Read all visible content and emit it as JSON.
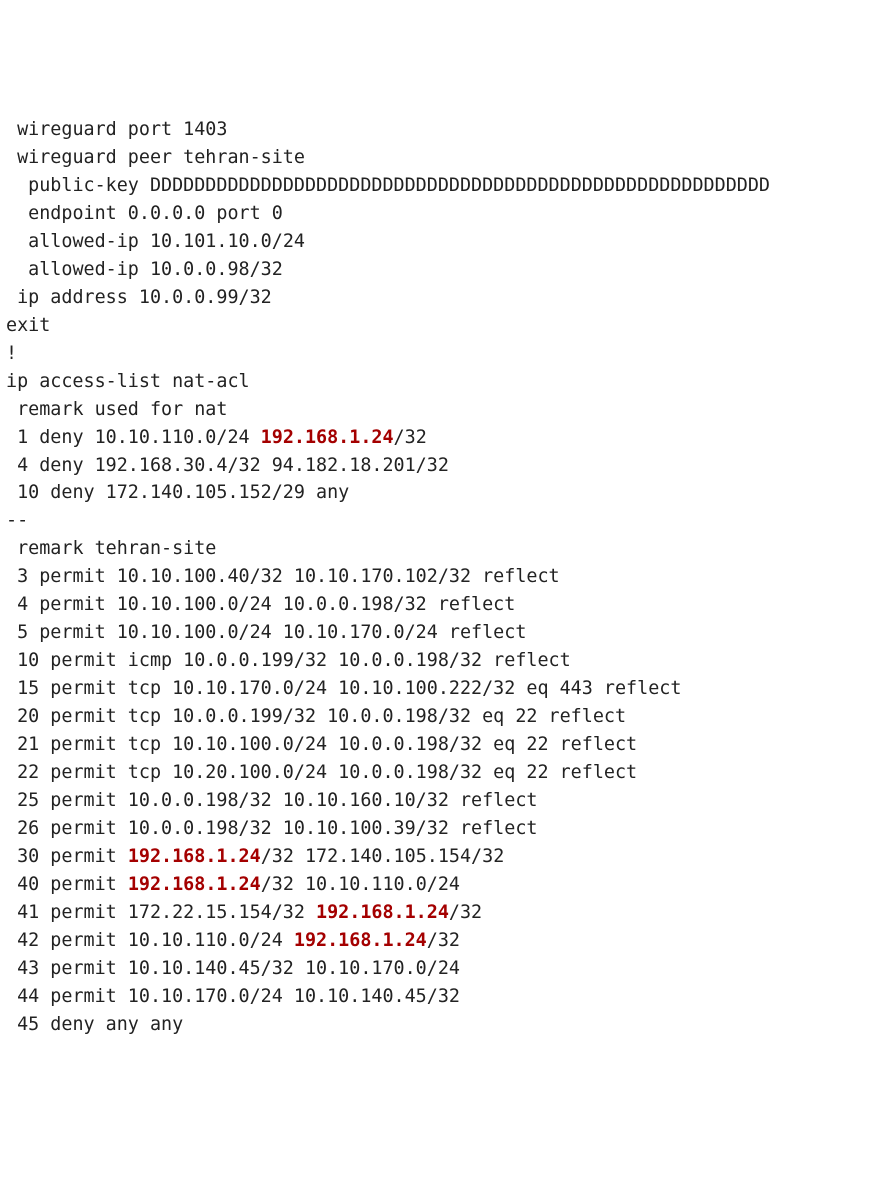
{
  "highlight_color": "#a40000",
  "lines": [
    {
      "indent": " ",
      "segments": [
        {
          "t": "wireguard port 1403"
        }
      ]
    },
    {
      "indent": " ",
      "segments": [
        {
          "t": "wireguard peer tehran-site"
        }
      ]
    },
    {
      "indent": "  ",
      "segments": [
        {
          "t": "public-key DDDDDDDDDDDDDDDDDDDDDDDDDDDDDDDDDDDDDDDDDDDDDDDDDDDDDDDD"
        }
      ]
    },
    {
      "indent": "  ",
      "segments": [
        {
          "t": "endpoint 0.0.0.0 port 0"
        }
      ]
    },
    {
      "indent": "  ",
      "segments": [
        {
          "t": "allowed-ip 10.101.10.0/24"
        }
      ]
    },
    {
      "indent": "  ",
      "segments": [
        {
          "t": "allowed-ip 10.0.0.98/32"
        }
      ]
    },
    {
      "indent": " ",
      "segments": [
        {
          "t": "ip address 10.0.0.99/32"
        }
      ]
    },
    {
      "indent": "",
      "segments": [
        {
          "t": "exit"
        }
      ]
    },
    {
      "indent": "",
      "segments": [
        {
          "t": "!"
        }
      ]
    },
    {
      "indent": "",
      "segments": [
        {
          "t": "ip access-list nat-acl"
        }
      ]
    },
    {
      "indent": " ",
      "segments": [
        {
          "t": "remark used for nat"
        }
      ]
    },
    {
      "indent": " ",
      "segments": [
        {
          "t": "1 deny 10.10.110.0/24 "
        },
        {
          "t": "192.168.1.24",
          "hl": true
        },
        {
          "t": "/32"
        }
      ]
    },
    {
      "indent": " ",
      "segments": [
        {
          "t": "4 deny 192.168.30.4/32 94.182.18.201/32"
        }
      ]
    },
    {
      "indent": " ",
      "segments": [
        {
          "t": "10 deny 172.140.105.152/29 any"
        }
      ]
    },
    {
      "indent": "",
      "segments": [
        {
          "t": "--"
        }
      ]
    },
    {
      "indent": " ",
      "segments": [
        {
          "t": "remark tehran-site"
        }
      ]
    },
    {
      "indent": " ",
      "segments": [
        {
          "t": "3 permit 10.10.100.40/32 10.10.170.102/32 reflect"
        }
      ]
    },
    {
      "indent": " ",
      "segments": [
        {
          "t": "4 permit 10.10.100.0/24 10.0.0.198/32 reflect"
        }
      ]
    },
    {
      "indent": " ",
      "segments": [
        {
          "t": "5 permit 10.10.100.0/24 10.10.170.0/24 reflect"
        }
      ]
    },
    {
      "indent": " ",
      "segments": [
        {
          "t": "10 permit icmp 10.0.0.199/32 10.0.0.198/32 reflect"
        }
      ]
    },
    {
      "indent": " ",
      "segments": [
        {
          "t": "15 permit tcp 10.10.170.0/24 10.10.100.222/32 eq 443 reflect"
        }
      ]
    },
    {
      "indent": " ",
      "segments": [
        {
          "t": "20 permit tcp 10.0.0.199/32 10.0.0.198/32 eq 22 reflect"
        }
      ]
    },
    {
      "indent": " ",
      "segments": [
        {
          "t": "21 permit tcp 10.10.100.0/24 10.0.0.198/32 eq 22 reflect"
        }
      ]
    },
    {
      "indent": " ",
      "segments": [
        {
          "t": "22 permit tcp 10.20.100.0/24 10.0.0.198/32 eq 22 reflect"
        }
      ]
    },
    {
      "indent": " ",
      "segments": [
        {
          "t": "25 permit 10.0.0.198/32 10.10.160.10/32 reflect"
        }
      ]
    },
    {
      "indent": " ",
      "segments": [
        {
          "t": "26 permit 10.0.0.198/32 10.10.100.39/32 reflect"
        }
      ]
    },
    {
      "indent": " ",
      "segments": [
        {
          "t": "30 permit "
        },
        {
          "t": "192.168.1.24",
          "hl": true
        },
        {
          "t": "/32 172.140.105.154/32"
        }
      ]
    },
    {
      "indent": " ",
      "segments": [
        {
          "t": "40 permit "
        },
        {
          "t": "192.168.1.24",
          "hl": true
        },
        {
          "t": "/32 10.10.110.0/24"
        }
      ]
    },
    {
      "indent": " ",
      "segments": [
        {
          "t": "41 permit 172.22.15.154/32 "
        },
        {
          "t": "192.168.1.24",
          "hl": true
        },
        {
          "t": "/32"
        }
      ]
    },
    {
      "indent": " ",
      "segments": [
        {
          "t": "42 permit 10.10.110.0/24 "
        },
        {
          "t": "192.168.1.24",
          "hl": true
        },
        {
          "t": "/32"
        }
      ]
    },
    {
      "indent": " ",
      "segments": [
        {
          "t": "43 permit 10.10.140.45/32 10.10.170.0/24"
        }
      ]
    },
    {
      "indent": " ",
      "segments": [
        {
          "t": "44 permit 10.10.170.0/24 10.10.140.45/32"
        }
      ]
    },
    {
      "indent": " ",
      "segments": [
        {
          "t": "45 deny any any"
        }
      ]
    }
  ]
}
